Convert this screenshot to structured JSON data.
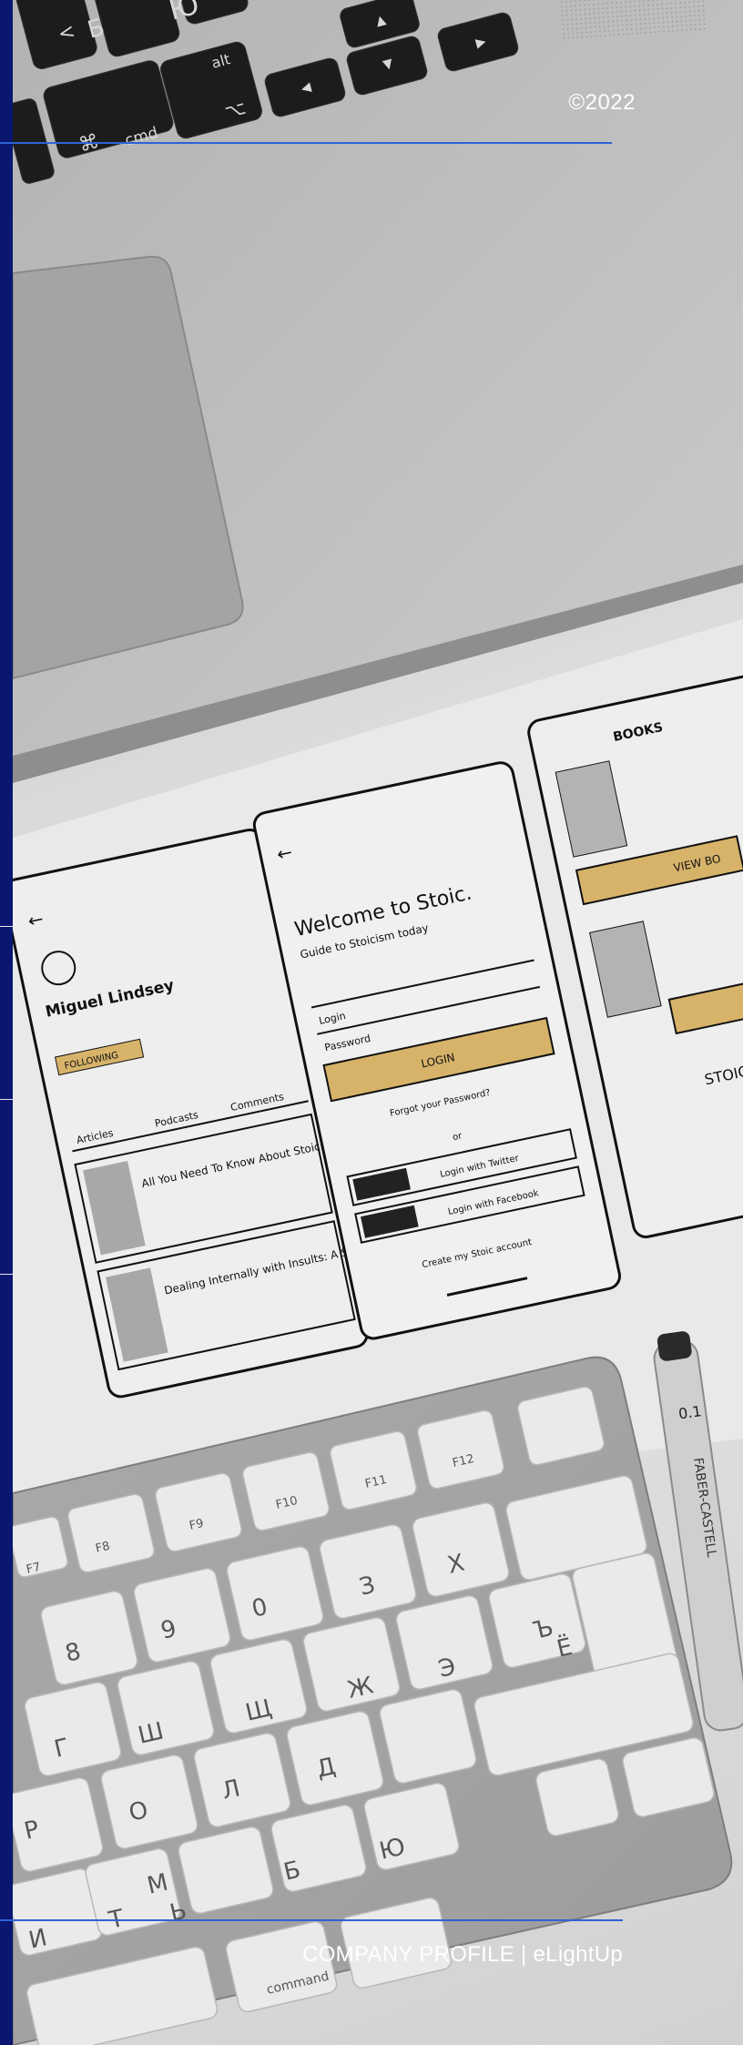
{
  "header": {
    "copyright": "©2022"
  },
  "footer": {
    "label": "COMPANY PROFILE | eLightUp"
  },
  "photo": {
    "description_icons": [
      "laptop-icon",
      "keyboard-icon",
      "pen-icon"
    ],
    "wireframes": {
      "profile_screen": {
        "name": "Miguel Lindsey",
        "follow_button": "FOLLOWING",
        "tabs": [
          "Articles",
          "Podcasts",
          "Comments"
        ],
        "article_1": "All You Need To Know About Stoicism In One Table",
        "article_2": "Dealing Internally with Insults: A Stoic Solution"
      },
      "login_screen": {
        "title": "Welcome to Stoic.",
        "subtitle": "Guide to Stoicism today",
        "login_field": "Login",
        "password_field": "Password",
        "login_button": "LOGIN",
        "forgot_link": "Forgot your Password?",
        "or_label": "or",
        "twitter_button": "Login with Twitter",
        "facebook_button": "Login with Facebook",
        "create_account": "Create my Stoic account"
      },
      "books_screen": {
        "title": "BOOKS",
        "view_button": "VIEW BO",
        "book_label": "STOIC TOD"
      }
    },
    "keyboard_keys": [
      "F7",
      "F8",
      "F9",
      "F10",
      "F11",
      "F12",
      "8",
      "9",
      "0",
      "З",
      "Х",
      "Ъ",
      "Ш",
      "Щ",
      "Ж",
      "Э",
      "Ё",
      "Р",
      "О",
      "Л",
      "Д",
      "Б",
      "Ю",
      "Ь",
      "И",
      "Т",
      "М",
      "Г",
      "command"
    ],
    "laptop_keys": [
      "Б",
      "Ю",
      "alt",
      "cmd"
    ],
    "pen_text": [
      "0.1",
      "FABER-CASTELL"
    ]
  }
}
